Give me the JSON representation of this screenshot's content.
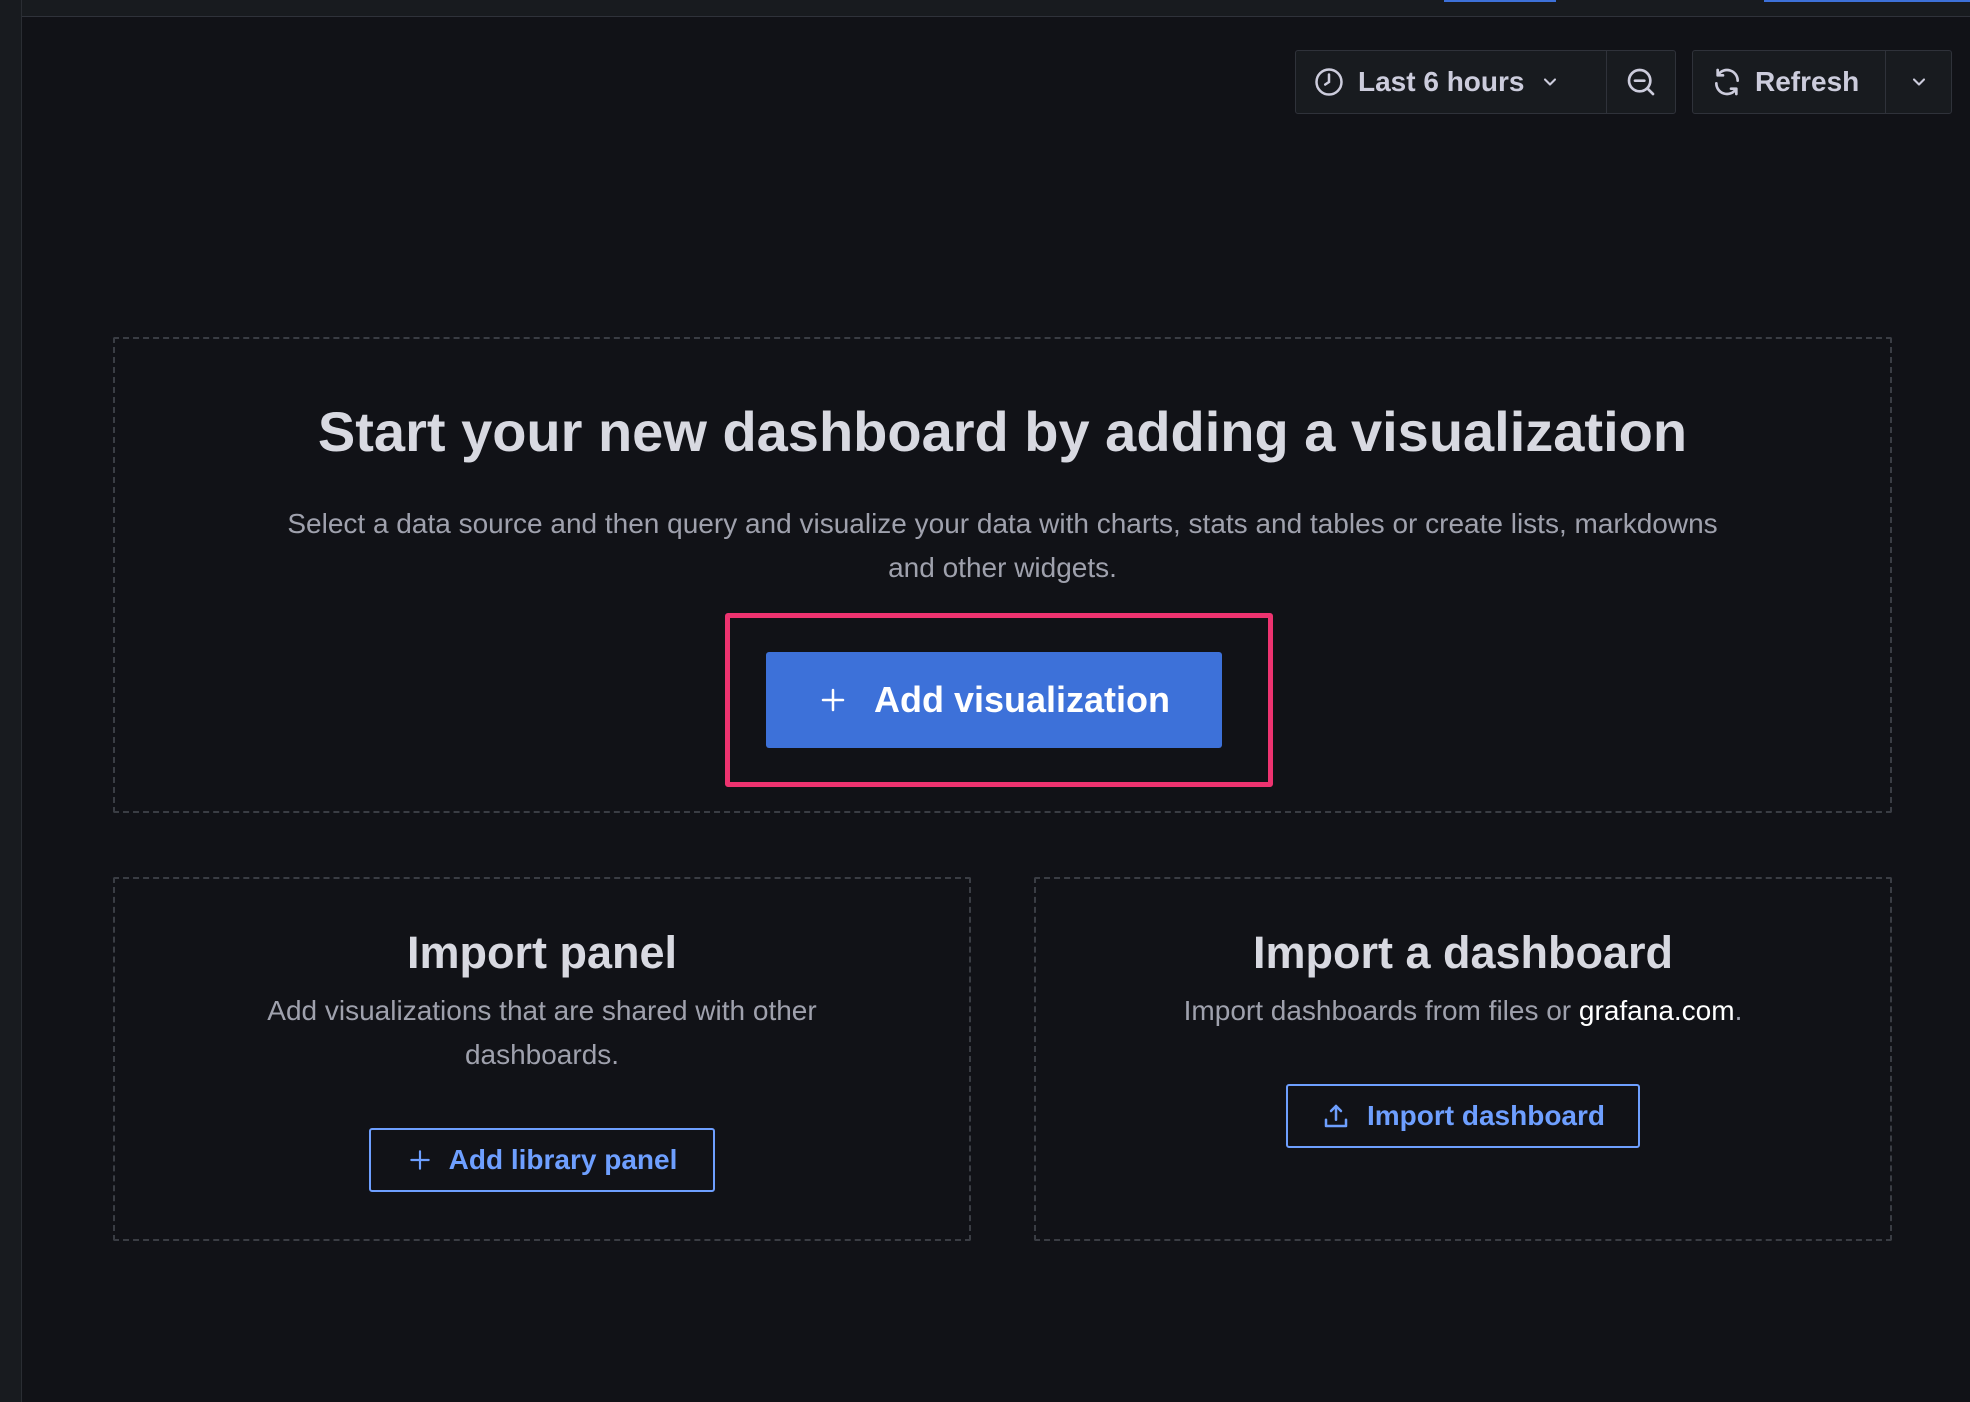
{
  "toolbar": {
    "time_range_label": "Last 6 hours",
    "refresh_label": "Refresh",
    "icons": {
      "time": "clock-icon",
      "time_caret": "chevron-down-icon",
      "zoom": "zoom-out-icon",
      "refresh": "sync-icon",
      "refresh_caret": "chevron-down-icon"
    }
  },
  "empty_state": {
    "title": "Start your new dashboard by adding a visualization",
    "description": "Select a data source and then query and visualize your data with charts, stats and tables or create lists, markdowns and other widgets.",
    "add_visualization_label": "Add visualization"
  },
  "library_panel": {
    "title": "Import panel",
    "description": "Add visualizations that are shared with other dashboards.",
    "button_label": "Add library panel"
  },
  "import_dashboard": {
    "title": "Import a dashboard",
    "description_prefix": "Import dashboards from files or ",
    "link_text": "grafana.com",
    "description_suffix": ".",
    "button_label": "Import dashboard"
  },
  "colors": {
    "background": "#111217",
    "primary": "#3d71d9",
    "primary_text": "#6e9fff",
    "highlight": "#ee3370",
    "border_dashed": "#3a3d44"
  }
}
